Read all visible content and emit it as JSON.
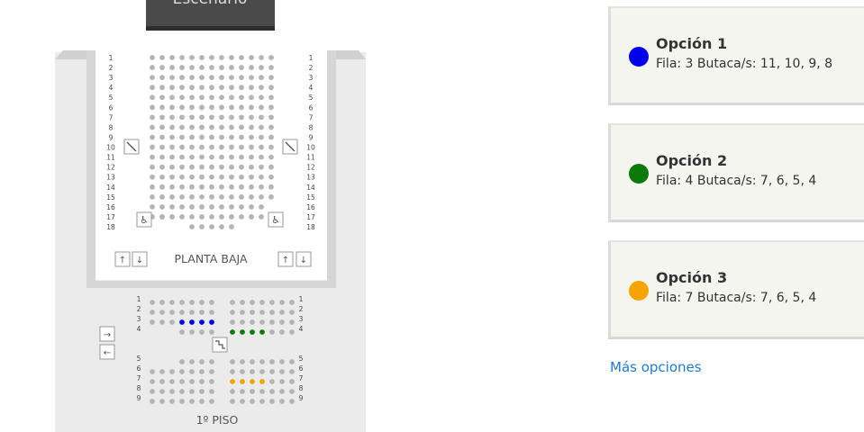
{
  "stage": {
    "label": "Escenario"
  },
  "planta_baja": {
    "label": "PLANTA BAJA",
    "row_numbers": [
      "1",
      "2",
      "3",
      "4",
      "5",
      "6",
      "7",
      "8",
      "9",
      "10",
      "11",
      "12",
      "13",
      "14",
      "15",
      "16",
      "17",
      "18"
    ],
    "icons": [
      "diagonal-stair-icon",
      "wheelchair-icon",
      "arrow-up-icon",
      "arrow-down-icon"
    ]
  },
  "primer_piso": {
    "label": "1º PISO",
    "row_numbers_top": [
      "1",
      "2",
      "3",
      "4"
    ],
    "row_numbers_bottom": [
      "5",
      "6",
      "7",
      "8",
      "9"
    ],
    "icons": [
      "arrow-right-icon",
      "arrow-left-icon",
      "stair-icon"
    ]
  },
  "options": [
    {
      "title": "Opción 1",
      "detail": "Fila: 3 Butaca/s: 11, 10, 9, 8",
      "color": "#0000ee",
      "row": 3,
      "seats": [
        11,
        10,
        9,
        8
      ]
    },
    {
      "title": "Opción 2",
      "detail": "Fila: 4 Butaca/s: 7, 6, 5, 4",
      "color": "#0b7a0b",
      "row": 4,
      "seats": [
        7,
        6,
        5,
        4
      ]
    },
    {
      "title": "Opción 3",
      "detail": "Fila: 7 Butaca/s: 7, 6, 5, 4",
      "color": "#f7a400",
      "row": 7,
      "seats": [
        7,
        6,
        5,
        4
      ]
    }
  ],
  "more_options": "Más opciones",
  "colors": {
    "seat": "#b4b4b4",
    "link": "#1e7bd3"
  }
}
